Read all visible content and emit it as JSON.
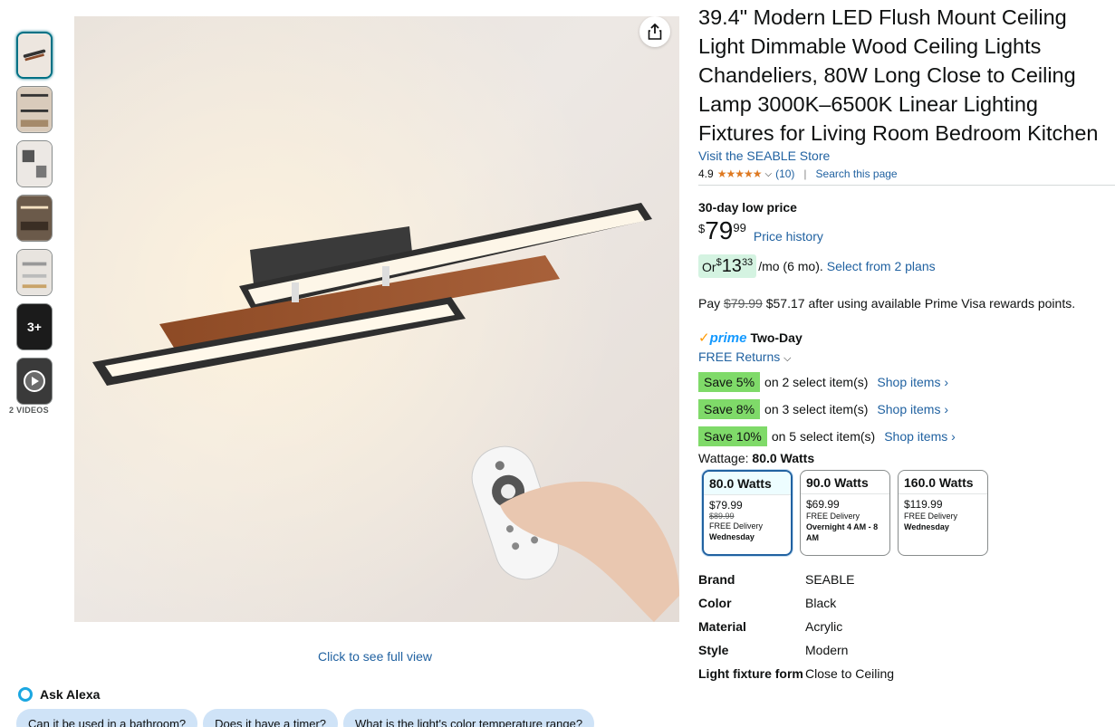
{
  "gallery": {
    "more_count": "3+",
    "videos_label": "2 VIDEOS",
    "full_view": "Click to see full view"
  },
  "alexa": {
    "label": "Ask Alexa",
    "chips": [
      "Can it be used in a bathroom?",
      "Does it have a timer?",
      "What is the light's color temperature range?"
    ]
  },
  "product": {
    "title": "39.4\" Modern LED Flush Mount Ceiling Light Dimmable Wood Ceiling Lights Chandeliers, 80W Long Close to Ceiling Lamp 3000K–6500K Linear Lighting Fixtures for Living Room Bedroom Kitchen",
    "store": "Visit the SEABLE Store",
    "rating": "4.9",
    "stars": "★★★★★",
    "review_count": "(10)",
    "search_page": "Search this page"
  },
  "price": {
    "low_label": "30-day low price",
    "currency": "$",
    "whole": "79",
    "fraction": "99",
    "history": "Price history",
    "plan_or": "Or ",
    "plan_whole": "13",
    "plan_frac": "33",
    "plan_term": "/mo (6 mo).",
    "plan_link": "Select from 2 plans",
    "visa_pay": "Pay ",
    "visa_old": "$79.99",
    "visa_rest": " $57.17 after using available Prime Visa rewards points."
  },
  "delivery": {
    "prime": "prime",
    "speed": "Two-Day",
    "returns": "FREE Returns"
  },
  "promos": [
    {
      "badge": "Save 5%",
      "text": "on 2 select item(s)",
      "link": "Shop items ›"
    },
    {
      "badge": "Save 8%",
      "text": "on 3 select item(s)",
      "link": "Shop items ›"
    },
    {
      "badge": "Save 10%",
      "text": "on 5 select item(s)",
      "link": "Shop items ›"
    }
  ],
  "wattage": {
    "label": "Wattage: ",
    "selected": "80.0 Watts",
    "options": [
      {
        "name": "80.0 Watts",
        "price": "$79.99",
        "list": "$89.99",
        "delivery": "FREE Delivery",
        "when": "Wednesday"
      },
      {
        "name": "90.0 Watts",
        "price": "$69.99",
        "delivery": "FREE Delivery",
        "when": "Overnight 4 AM - 8 AM"
      },
      {
        "name": "160.0 Watts",
        "price": "$119.99",
        "delivery": "FREE Delivery",
        "when": "Wednesday"
      }
    ]
  },
  "specs": [
    {
      "key": "Brand",
      "value": "SEABLE"
    },
    {
      "key": "Color",
      "value": "Black"
    },
    {
      "key": "Material",
      "value": "Acrylic"
    },
    {
      "key": "Style",
      "value": "Modern"
    },
    {
      "key": "Light fixture form",
      "value": "Close to Ceiling"
    }
  ]
}
